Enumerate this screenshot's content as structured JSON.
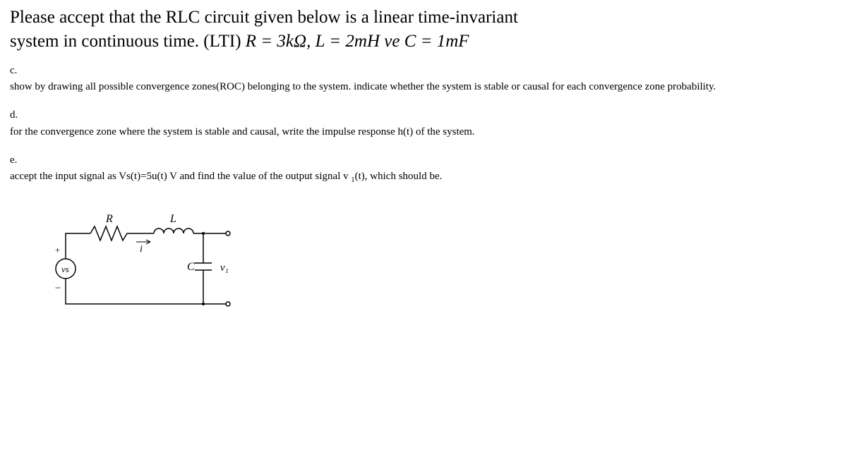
{
  "intro": {
    "line1": "Please accept that the RLC circuit given below is a linear time-invariant",
    "line2_prefix": "system in continuous time. (LTI) ",
    "line2_math": "R = 3kΩ, L = 2mH ve C = 1mF"
  },
  "sections": {
    "c": {
      "label": "c.",
      "text": "show by drawing all possible convergence zones(ROC) belonging to the system. indicate whether the system is stable or causal for each convergence zone probability."
    },
    "d": {
      "label": "d.",
      "text": "for the convergence zone where the system is stable and causal, write the impulse response h(t) of the system."
    },
    "e": {
      "label": "e.",
      "text_before": "accept the input signal as Vs(t)=5u(t) V and find the value of the output signal v ",
      "text_sub": "1",
      "text_after": "(t), which should be."
    }
  },
  "circuit": {
    "R": "R",
    "L": "L",
    "C": "C",
    "i": "i",
    "vs": "vs",
    "v1": "v₁",
    "plus": "+",
    "minus": "−"
  }
}
